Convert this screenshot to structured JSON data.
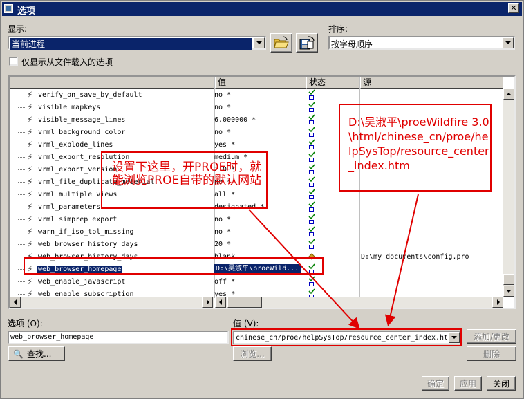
{
  "window": {
    "title": "选项",
    "close_glyph": "✕"
  },
  "display": {
    "label": "显示:",
    "current": "当前进程"
  },
  "sort": {
    "label": "排序:",
    "current": "按字母顺序"
  },
  "filter_checkbox": {
    "label": "仅显示从文件载入的选项",
    "checked": false
  },
  "table": {
    "columns": [
      "",
      "值",
      "状态",
      "源"
    ],
    "rows": [
      {
        "name": "verify_on_save_by_default",
        "value": "no *",
        "status": "check",
        "source": ""
      },
      {
        "name": "visible_mapkeys",
        "value": "no *",
        "status": "check",
        "source": ""
      },
      {
        "name": "visible_message_lines",
        "value": "6.000000 *",
        "status": "check",
        "source": ""
      },
      {
        "name": "vrml_background_color",
        "value": "no *",
        "status": "check",
        "source": ""
      },
      {
        "name": "vrml_explode_lines",
        "value": "yes *",
        "status": "check",
        "source": ""
      },
      {
        "name": "vrml_export_resolution",
        "value": "medium *",
        "status": "check",
        "source": ""
      },
      {
        "name": "vrml_export_version",
        "value": "2.0 *",
        "status": "check",
        "source": ""
      },
      {
        "name": "vrml_file_duplicate_material",
        "value": "no *",
        "status": "check",
        "source": ""
      },
      {
        "name": "vrml_multiple_views",
        "value": "all *",
        "status": "check",
        "source": ""
      },
      {
        "name": "vrml_parameters",
        "value": "designated *",
        "status": "check",
        "source": ""
      },
      {
        "name": "vrml_simprep_export",
        "value": "no *",
        "status": "check",
        "source": ""
      },
      {
        "name": "warn_if_iso_tol_missing",
        "value": "no *",
        "status": "check",
        "source": ""
      },
      {
        "name": "web_browser_history_days",
        "value": "20 *",
        "status": "check",
        "source": ""
      },
      {
        "name": "web_browser_history_days",
        "value": "blank",
        "status": "diamond",
        "source": "D:\\my documents\\config.pro"
      },
      {
        "name": "web_browser_homepage",
        "value": "D:\\吴淑平\\proeWild...",
        "status": "check",
        "source": "",
        "selected": true
      },
      {
        "name": "web_enable_javascript",
        "value": "off *",
        "status": "check",
        "source": ""
      },
      {
        "name": "web_enable_subscription",
        "value": "yes *",
        "status": "check",
        "source": ""
      }
    ]
  },
  "option_field": {
    "label": "选项 (O):",
    "value": "web_browser_homepage"
  },
  "value_field": {
    "label": "值 (V):",
    "value": "chinese_cn/proe/helpSysTop/resource_center_index.htm"
  },
  "buttons": {
    "find": "查找...",
    "browse": "浏览...",
    "add_change": "添加/更改",
    "delete": "删除",
    "ok": "确定",
    "apply": "应用",
    "close": "关闭"
  },
  "annotations": {
    "note1": "设置下这里，开PROE时，就能浏览PROE自带的默认网站",
    "note2": "D:\\吴淑平\\proeWildfire 3.0 \\html/chinese_cn/proe/helpSysTop/resource_center_index.htm"
  },
  "colors": {
    "selection": "#0a246a",
    "annotation": "#e00000",
    "titlebar": "#0a246a"
  }
}
